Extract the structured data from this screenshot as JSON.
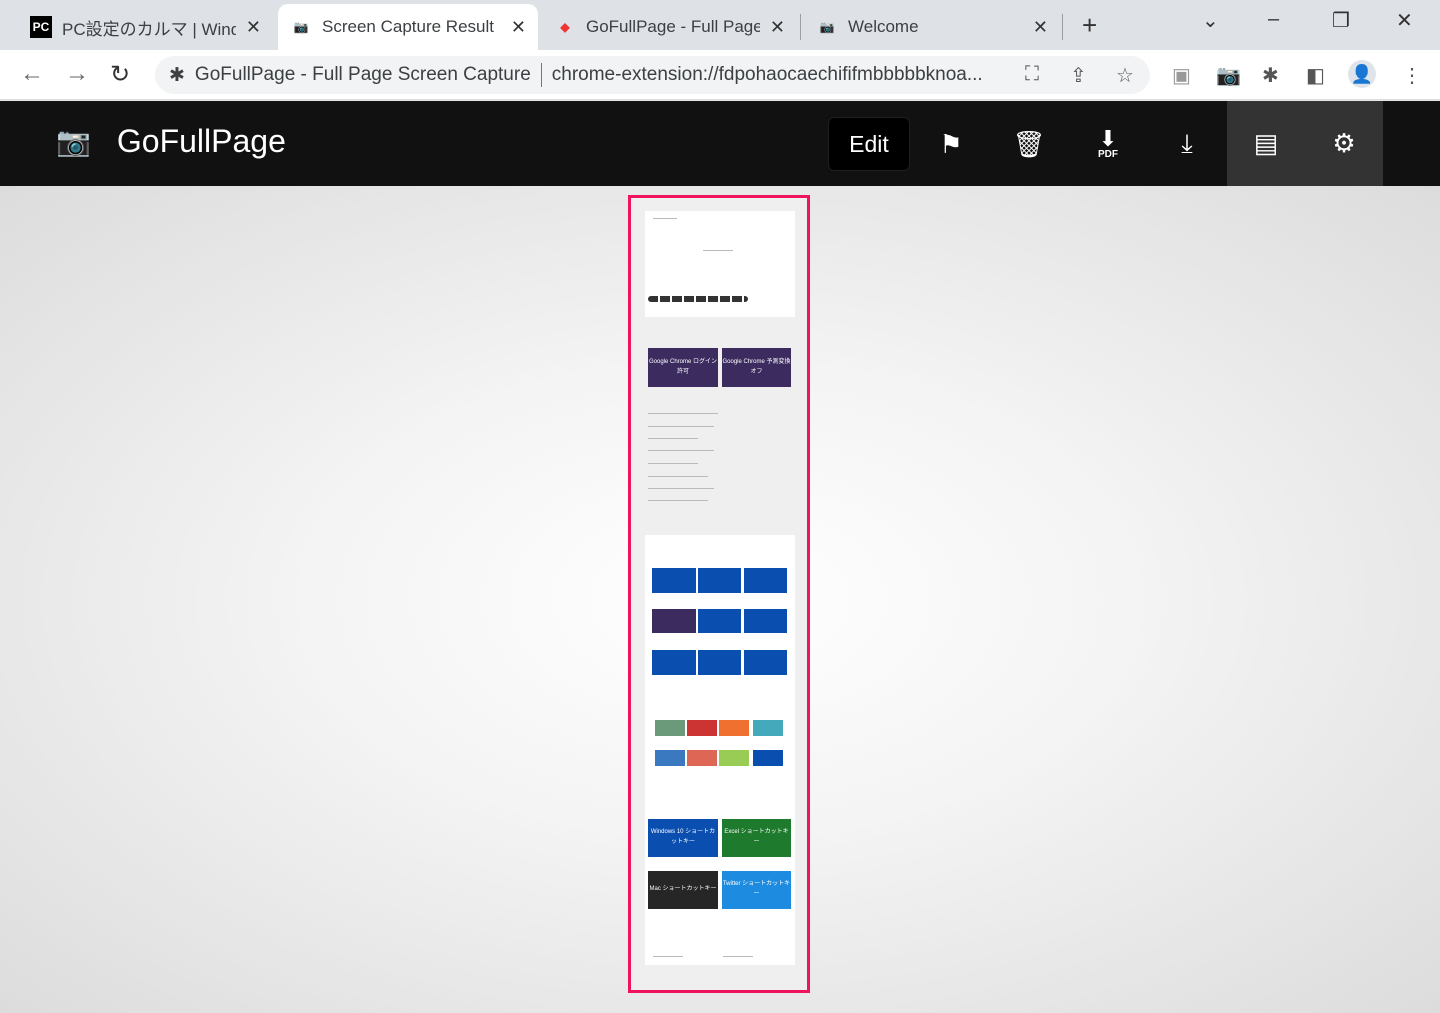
{
  "tabs": [
    {
      "title": "PC設定のカルマ | Windows",
      "favicon": "PC"
    },
    {
      "title": "Screen Capture Result",
      "favicon": "camera-icon",
      "active": true
    },
    {
      "title": "GoFullPage - Full Page Screen Capture",
      "favicon": "chrome-store-icon"
    },
    {
      "title": "Welcome",
      "favicon": "camera-icon"
    }
  ],
  "address": {
    "site_name": "GoFullPage - Full Page Screen Capture",
    "url": "chrome-extension://fdpohaocaechififmbbbbbknoa..."
  },
  "app": {
    "title": "GoFullPage",
    "edit_label": "Edit",
    "pdf_label": "PDF"
  },
  "colors": {
    "highlight": "#f0135f",
    "header": "#111111",
    "tile_purple": "#3b2b5e",
    "tile_blue": "#0a4fb0",
    "tile_green": "#1e7a2d",
    "tile_dark": "#262626",
    "tile_sky": "#1d8ce0"
  },
  "preview": {
    "featured": [
      "Google Chrome ログイン許可",
      "Google Chrome 予測変換 オフ"
    ],
    "shortcuts": [
      "Windows 10 ショートカットキー",
      "Excel ショートカットキー",
      "Mac ショートカットキー",
      "Twitter ショートカットキー"
    ]
  }
}
